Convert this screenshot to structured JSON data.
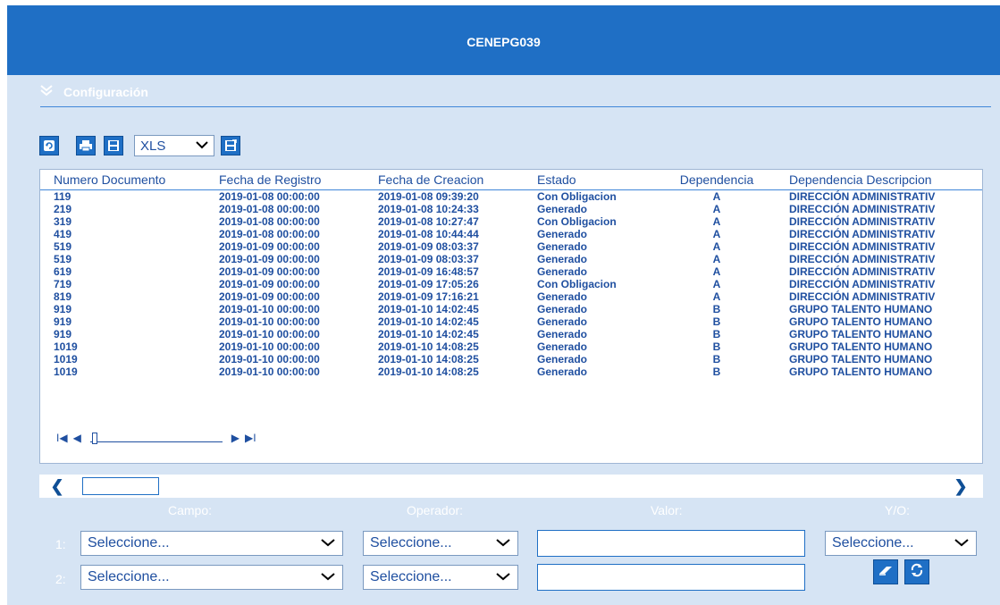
{
  "window": {
    "title": "CENEPG039"
  },
  "section": {
    "label": "Configuración"
  },
  "toolbar": {
    "refresh_icon": "refresh-icon",
    "print_icon": "print-icon",
    "save_icon": "save-icon",
    "export_format": "XLS",
    "export_icon": "export-icon"
  },
  "table": {
    "columns": [
      "Numero Documento",
      "Fecha de Registro",
      "Fecha de Creacion",
      "Estado",
      "Dependencia",
      "Dependencia Descripcion"
    ],
    "rows": [
      [
        "119",
        "2019-01-08 00:00:00",
        "2019-01-08 09:39:20",
        "Con Obligacion",
        "A",
        "DIRECCIÓN ADMINISTRATIV"
      ],
      [
        "219",
        "2019-01-08 00:00:00",
        "2019-01-08 10:24:33",
        "Generado",
        "A",
        "DIRECCIÓN ADMINISTRATIV"
      ],
      [
        "319",
        "2019-01-08 00:00:00",
        "2019-01-08 10:27:47",
        "Con Obligacion",
        "A",
        "DIRECCIÓN ADMINISTRATIV"
      ],
      [
        "419",
        "2019-01-08 00:00:00",
        "2019-01-08 10:44:44",
        "Generado",
        "A",
        "DIRECCIÓN ADMINISTRATIV"
      ],
      [
        "519",
        "2019-01-09 00:00:00",
        "2019-01-09 08:03:37",
        "Generado",
        "A",
        "DIRECCIÓN ADMINISTRATIV"
      ],
      [
        "519",
        "2019-01-09 00:00:00",
        "2019-01-09 08:03:37",
        "Generado",
        "A",
        "DIRECCIÓN ADMINISTRATIV"
      ],
      [
        "619",
        "2019-01-09 00:00:00",
        "2019-01-09 16:48:57",
        "Generado",
        "A",
        "DIRECCIÓN ADMINISTRATIV"
      ],
      [
        "719",
        "2019-01-09 00:00:00",
        "2019-01-09 17:05:26",
        "Con Obligacion",
        "A",
        "DIRECCIÓN ADMINISTRATIV"
      ],
      [
        "819",
        "2019-01-09 00:00:00",
        "2019-01-09 17:16:21",
        "Generado",
        "A",
        "DIRECCIÓN ADMINISTRATIV"
      ],
      [
        "919",
        "2019-01-10 00:00:00",
        "2019-01-10 14:02:45",
        "Generado",
        "B",
        "GRUPO TALENTO HUMANO"
      ],
      [
        "919",
        "2019-01-10 00:00:00",
        "2019-01-10 14:02:45",
        "Generado",
        "B",
        "GRUPO TALENTO HUMANO"
      ],
      [
        "919",
        "2019-01-10 00:00:00",
        "2019-01-10 14:02:45",
        "Generado",
        "B",
        "GRUPO TALENTO HUMANO"
      ],
      [
        "1019",
        "2019-01-10 00:00:00",
        "2019-01-10 14:08:25",
        "Generado",
        "B",
        "GRUPO TALENTO HUMANO"
      ],
      [
        "1019",
        "2019-01-10 00:00:00",
        "2019-01-10 14:08:25",
        "Generado",
        "B",
        "GRUPO TALENTO HUMANO"
      ],
      [
        "1019",
        "2019-01-10 00:00:00",
        "2019-01-10 14:08:25",
        "Generado",
        "B",
        "GRUPO TALENTO HUMANO"
      ]
    ]
  },
  "pager": {
    "first": "I◀",
    "prev": "◀",
    "next": "▶",
    "last": "▶I"
  },
  "scroll": {
    "left": "❮",
    "right": "❯"
  },
  "filter": {
    "headers": {
      "campo": "Campo:",
      "operador": "Operador:",
      "valor": "Valor:",
      "yo": "Y/O:"
    },
    "rows": [
      {
        "index": "1:",
        "campo": "Seleccione...",
        "operador": "Seleccione...",
        "valor": "",
        "yo": "Seleccione..."
      },
      {
        "index": "2:",
        "campo": "Seleccione...",
        "operador": "Seleccione...",
        "valor": ""
      }
    ],
    "clear_icon": "eraser-icon",
    "apply_icon": "filter-refresh-icon"
  },
  "colors": {
    "header_blue": "#1f6fc5",
    "panel_bg": "#d6e4f4",
    "text_blue": "#1f4fa0"
  }
}
